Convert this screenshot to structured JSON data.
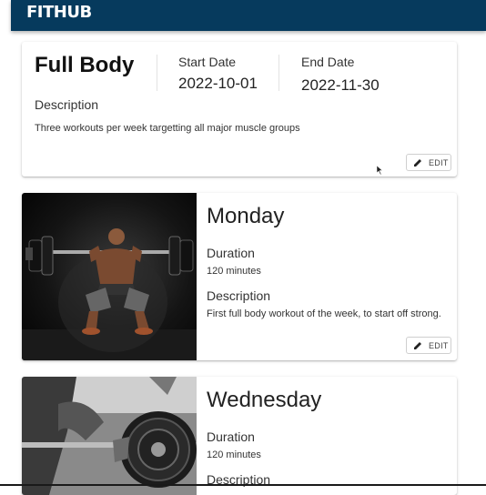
{
  "app": {
    "brand": "FITHUB"
  },
  "program": {
    "name": "Full Body",
    "start_label": "Start Date",
    "start_value": "2022-10-01",
    "end_label": "End Date",
    "end_value": "2022-11-30",
    "description_label": "Description",
    "description": "Three workouts per week targetting all major muscle groups",
    "edit_label": "EDIT"
  },
  "workouts": [
    {
      "day": "Monday",
      "duration_label": "Duration",
      "duration": "120 minutes",
      "description_label": "Description",
      "description": "First full body workout of the week, to start off strong.",
      "edit_label": "EDIT",
      "image": "barbell-squat-photo"
    },
    {
      "day": "Wednesday",
      "duration_label": "Duration",
      "duration": "120 minutes",
      "description_label": "Description",
      "image": "deadlift-photo"
    }
  ],
  "colors": {
    "appbar": "#063a5d",
    "brand_text": "#ffffff"
  }
}
